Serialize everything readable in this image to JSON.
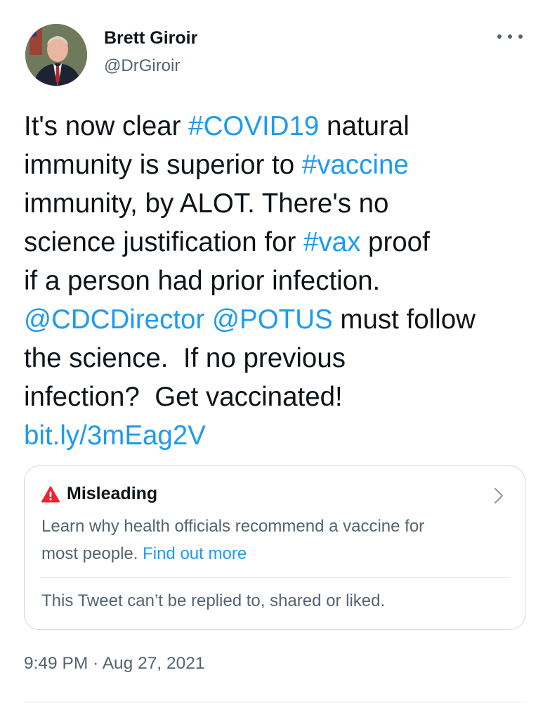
{
  "author": {
    "name": "Brett Giroir",
    "handle": "@DrGiroir"
  },
  "icons": {
    "more": "more-options-icon",
    "warning": "warning-icon",
    "chevron": "chevron-right-icon"
  },
  "colors": {
    "link": "#1d9bf0",
    "text": "#0f1419",
    "muted": "#536471",
    "warning": "#f4212e",
    "border": "#cfd9de"
  },
  "tweet": {
    "segments": [
      {
        "text": "It's now clear ",
        "type": "text"
      },
      {
        "text": "#COVID19",
        "type": "hashtag"
      },
      {
        "text": " natural\nimmunity is superior to ",
        "type": "text"
      },
      {
        "text": "#vaccine",
        "type": "hashtag"
      },
      {
        "text": "\nimmunity, by ALOT. There's no\nscience justification for ",
        "type": "text"
      },
      {
        "text": "#vax",
        "type": "hashtag"
      },
      {
        "text": " proof\nif a person had prior infection.\n",
        "type": "text"
      },
      {
        "text": "@CDCDirector",
        "type": "mention"
      },
      {
        "text": " ",
        "type": "text"
      },
      {
        "text": "@POTUS",
        "type": "mention"
      },
      {
        "text": " must follow\nthe science.  If no previous\ninfection?  Get vaccinated!\n",
        "type": "text"
      },
      {
        "text": "bit.ly/3mEag2V",
        "type": "url"
      }
    ]
  },
  "notice": {
    "title": "Misleading",
    "body": "Learn why health officials recommend a vaccine for\nmost people.",
    "link": "Find out more",
    "footer": "This Tweet can’t be replied to, shared or liked."
  },
  "meta": {
    "time": "9:49 PM",
    "separator": "·",
    "date": "Aug 27, 2021"
  }
}
